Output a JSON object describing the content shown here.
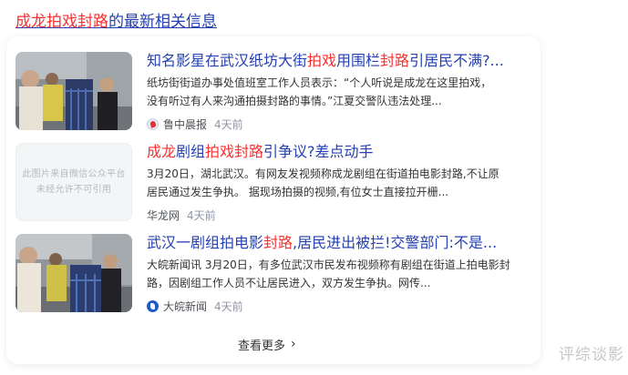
{
  "header": {
    "title_highlight": "成龙拍戏封路",
    "title_rest": "的最新相关信息"
  },
  "items": [
    {
      "title_parts": [
        "知名影星在武汉纸坊大街",
        "拍戏",
        "用围栏",
        "封路",
        "引居民不满?..."
      ],
      "summary_line1": "纸坊街街道办事处值班室工作人员表示：“个人听说是成龙在这里拍戏，",
      "summary_line2": "没有听过有人来沟通拍摄封路的事情。”江夏交警队违法处理...",
      "source": "鲁中晨报",
      "time": "4天前",
      "source_icon": "luzhong-logo-icon",
      "thumb": "photo"
    },
    {
      "title_parts": [
        "成龙",
        "剧组",
        "拍戏封路",
        "引争议?差点动手"
      ],
      "summary_line1": "3月20日，湖北武汉。有网友发视频称成龙剧组在街道拍电影封路,不让原",
      "summary_line2": "居民通过发生争执。 据现场拍摄的视频,有位女士直接拉开栅...",
      "source": "华龙网",
      "time": "4天前",
      "thumb_placeholder_line1": "此图片来自微信公众平台",
      "thumb_placeholder_line2": "未经允许不可引用",
      "thumb": "placeholder"
    },
    {
      "title_parts": [
        "武汉一剧组拍电影",
        "封路",
        ",居民进出被拦!交警部门:不是..."
      ],
      "summary_line1": "大皖新闻讯 3月20日，有多位武汉市民发布视频称有剧组在街道上拍电影封",
      "summary_line2": "路，因剧组工作人员不让居民进入，双方发生争执。网传...",
      "source": "大皖新闻",
      "time": "4天前",
      "source_icon": "anhui-news-logo-icon",
      "thumb": "photo"
    }
  ],
  "more_label": "查看更多",
  "watermark": "评综谈影",
  "colors": {
    "link": "#2440b3",
    "highlight": "#f73131",
    "meta": "#9195a3"
  }
}
